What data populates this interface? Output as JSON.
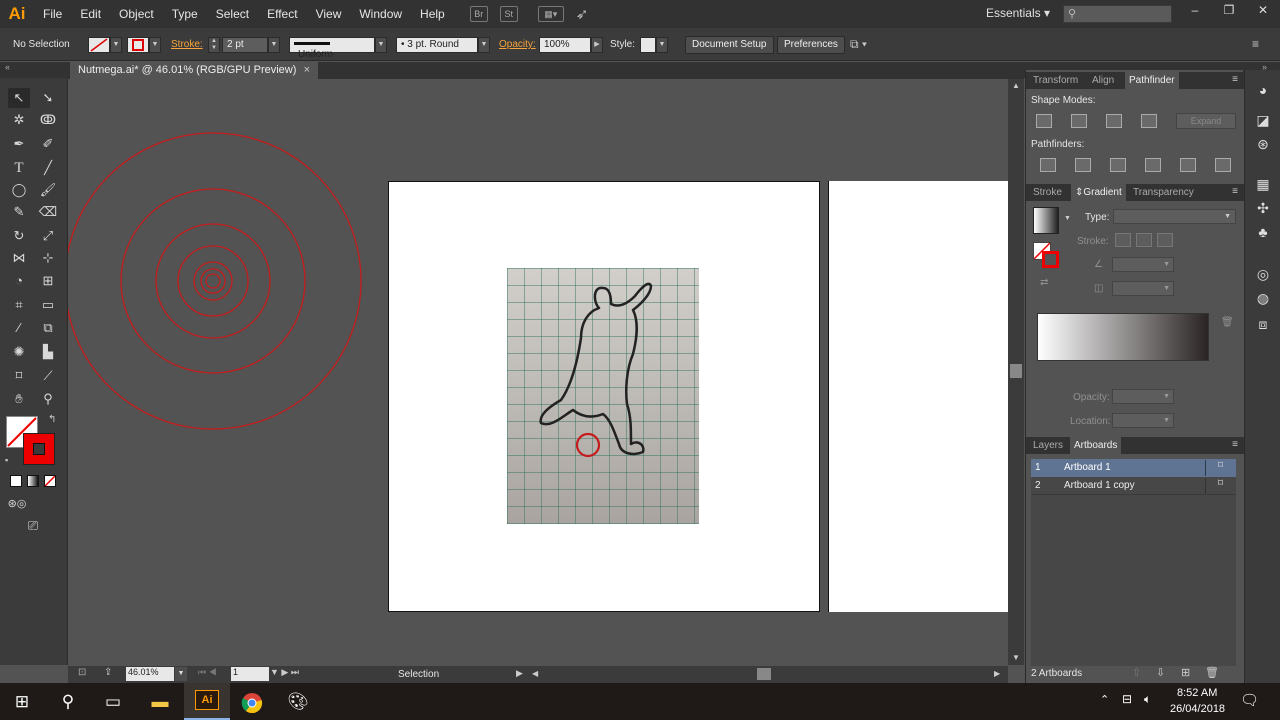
{
  "app": {
    "logo": "Ai"
  },
  "menu": [
    "File",
    "Edit",
    "Object",
    "Type",
    "Select",
    "Effect",
    "View",
    "Window",
    "Help"
  ],
  "menubar_icons": {
    "bridge": "Br",
    "stock": "St"
  },
  "workspace": {
    "label": "Essentials"
  },
  "window_controls": {
    "minimize": "–",
    "maximize": "❐",
    "close": "✕"
  },
  "control_bar": {
    "selection": "No Selection",
    "stroke_label": "Stroke:",
    "stroke_weight": "2 pt",
    "profile": "Uniform",
    "brush": "3 pt. Round",
    "opacity_label": "Opacity:",
    "opacity": "100%",
    "style_label": "Style:",
    "document_setup": "Document Setup",
    "preferences": "Preferences"
  },
  "document": {
    "tab_title": "Nutmega.ai* @ 46.01% (RGB/GPU Preview)",
    "close": "×"
  },
  "status": {
    "zoom": "46.01%",
    "artboard_num": "1",
    "tool": "Selection"
  },
  "pathfinder_panel": {
    "tabs": [
      "Transform",
      "Align",
      "Pathfinder"
    ],
    "active": "Pathfinder",
    "shape_modes": "Shape Modes:",
    "pathfinders": "Pathfinders:",
    "expand": "Expand"
  },
  "gradient_panel": {
    "tabs": [
      "Stroke",
      "Gradient",
      "Transparency"
    ],
    "active": "Gradient",
    "type_label": "Type:",
    "stroke_label": "Stroke:",
    "opacity_label": "Opacity:",
    "location_label": "Location:"
  },
  "layers_panel": {
    "tabs": [
      "Layers",
      "Artboards"
    ],
    "active": "Artboards",
    "artboards": [
      {
        "num": "1",
        "name": "Artboard 1"
      },
      {
        "num": "2",
        "name": "Artboard 1 copy"
      }
    ],
    "count": "2 Artboards"
  },
  "taskbar": {
    "time": "8:52 AM",
    "date": "26/04/2018",
    "ai_icon": "Ai"
  },
  "colors": {
    "accent": "#ff9a00",
    "stroke_red": "#cc1f1f",
    "selection_blue": "#5f7492"
  }
}
